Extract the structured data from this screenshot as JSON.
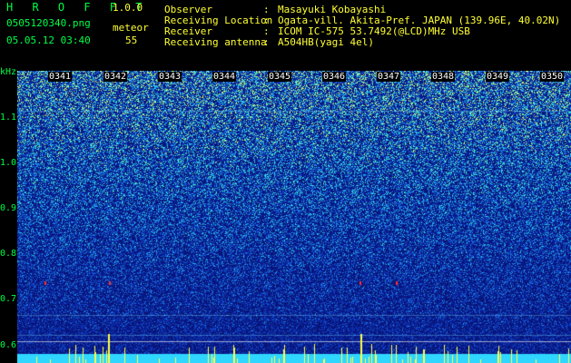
{
  "header": {
    "app_title": "H R O F F T",
    "version": "1.0.0",
    "filename": "0505120340.png",
    "meteor_label": "meteor",
    "datetime": "05.05.12 03:40",
    "meteor_count": "55",
    "info": [
      {
        "key": "Observer",
        "sep": ":",
        "value": "Masayuki Kobayashi"
      },
      {
        "key": "Receiving Location",
        "sep": ":",
        "value": "Ogata-vill. Akita-Pref. JAPAN (139.96E, 40.02N)"
      },
      {
        "key": "Receiver",
        "sep": ":",
        "value": "ICOM IC-575 53.7492(@LCD)MHz USB"
      },
      {
        "key": "Receiving antenna",
        "sep": ":",
        "value": "A504HB(yagi 4el)"
      }
    ]
  },
  "axis": {
    "unit": "kHz",
    "freq_ticks": [
      "1.1",
      "1.0",
      "0.9",
      "0.8",
      "0.7",
      "0.6"
    ],
    "time_ticks": [
      "0341",
      "0342",
      "0343",
      "0344",
      "0345",
      "0346",
      "0347",
      "0348",
      "0349",
      "0350"
    ]
  },
  "colors": {
    "header_green": "#00ff44",
    "header_yellow": "#ffff33",
    "spectrogram_base": "#0a1e8c"
  }
}
